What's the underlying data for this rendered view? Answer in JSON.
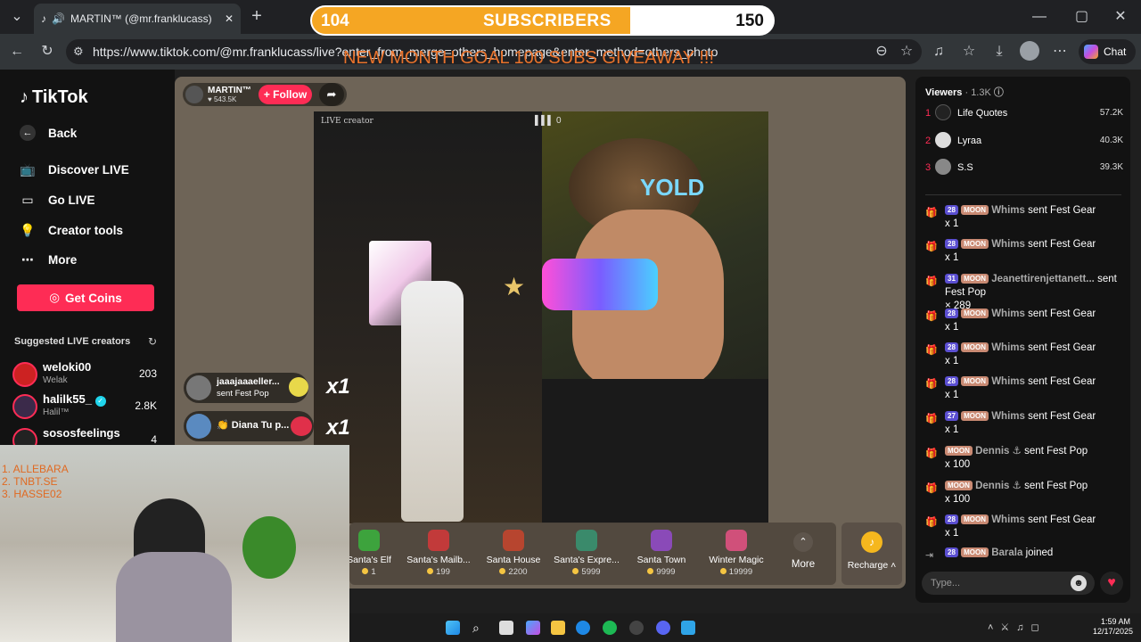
{
  "browser": {
    "tab_title": "MARTIN™ (@mr.franklucass)",
    "url": "https://www.tiktok.com/@mr.franklucass/live?enter_from_merge=others_homepage&enter_method=others_photo",
    "chat_label": "Chat"
  },
  "overlay": {
    "sub_current": "104",
    "sub_label": "SUBSCRIBERS",
    "sub_target": "150",
    "sub_progress": 0.69,
    "goal_text": "NEW MONTH GOAL 100 SUBS GIVEAWAY !!!"
  },
  "sidebar": {
    "logo": "TikTok",
    "back": "Back",
    "nav": [
      {
        "label": "Discover LIVE",
        "icon": "tv-icon"
      },
      {
        "label": "Go LIVE",
        "icon": "camera-icon"
      },
      {
        "label": "Creator tools",
        "icon": "lightbulb-icon"
      },
      {
        "label": "More",
        "icon": "ellipsis-icon"
      }
    ],
    "get_coins": "Get Coins",
    "suggested_title": "Suggested LIVE creators",
    "creators": [
      {
        "name": "weloki00",
        "sub": "Welak",
        "count": "203"
      },
      {
        "name": "halilk55_",
        "sub": "Halil™",
        "count": "2.8K"
      },
      {
        "name": "sososfeelings",
        "sub": "",
        "count": "4"
      }
    ]
  },
  "live": {
    "host_name": "MARTIN™",
    "host_likes": "543.5K",
    "follow": "+ Follow",
    "video_label": "LIVE creator",
    "video_count": "0",
    "gift_messages": [
      {
        "user": "jaaajaaaeller...",
        "text": "sent Fest Pop",
        "mult": "x1"
      },
      {
        "user": "Diana Tu p...",
        "text": "",
        "mult": "x1"
      }
    ],
    "gifts": [
      {
        "name": "Santa's Elf",
        "price": "1",
        "color": "#3da33d"
      },
      {
        "name": "Santa's Mailb...",
        "price": "199",
        "color": "#c23a3a"
      },
      {
        "name": "Santa House",
        "price": "2200",
        "color": "#b7452f"
      },
      {
        "name": "Santa's Expre...",
        "price": "5999",
        "color": "#3a8a6b"
      },
      {
        "name": "Santa Town",
        "price": "9999",
        "color": "#8a4ab8"
      },
      {
        "name": "Winter Magic",
        "price": "19999",
        "color": "#d0507a"
      }
    ],
    "more": "More",
    "recharge": "Recharge"
  },
  "viewers": {
    "title": "Viewers",
    "count": "1.3K",
    "list": [
      {
        "rank": "1",
        "name": "Life Quotes",
        "value": "57.2K"
      },
      {
        "rank": "2",
        "name": "Lyraa",
        "value": "40.3K"
      },
      {
        "rank": "3",
        "name": "S.S",
        "value": "39.3K"
      }
    ]
  },
  "chat": {
    "messages": [
      {
        "level": "28",
        "badge": "MOON",
        "name": "Whims",
        "action": "sent Fest Gear",
        "qty": "x 1"
      },
      {
        "level": "28",
        "badge": "MOON",
        "name": "Whims",
        "action": "sent Fest Gear",
        "qty": "x 1"
      },
      {
        "level": "31",
        "badge": "MOON",
        "name": "Jeanettirenjettanett...",
        "action": "sent Fest Pop",
        "qty": "× 289"
      },
      {
        "level": "28",
        "badge": "MOON",
        "name": "Whims",
        "action": "sent Fest Gear",
        "qty": "x 1"
      },
      {
        "level": "28",
        "badge": "MOON",
        "name": "Whims",
        "action": "sent Fest Gear",
        "qty": "x 1"
      },
      {
        "level": "28",
        "badge": "MOON",
        "name": "Whims",
        "action": "sent Fest Gear",
        "qty": "x 1"
      },
      {
        "level": "27",
        "badge": "MOON",
        "name": "Whims",
        "action": "sent Fest Gear",
        "qty": "x 1"
      },
      {
        "level": "",
        "badge": "MOON",
        "name": "Dennis ⚓",
        "action": "sent Fest Pop",
        "qty": "x 100"
      },
      {
        "level": "",
        "badge": "MOON",
        "name": "Dennis ⚓",
        "action": "sent Fest Pop",
        "qty": "x 100"
      },
      {
        "level": "28",
        "badge": "MOON",
        "name": "Whims",
        "action": "sent Fest Gear",
        "qty": "x 1"
      },
      {
        "level": "28",
        "badge": "MOON",
        "name": "Barala",
        "action": "joined",
        "qty": ""
      }
    ],
    "placeholder": "Type..."
  },
  "webcam": {
    "list": [
      "1.  ALLEBARA",
      "2.  TNBT.SE",
      "3.  HASSE02"
    ]
  },
  "taskbar": {
    "time": "1:59 AM",
    "date": "12/17/2025"
  }
}
